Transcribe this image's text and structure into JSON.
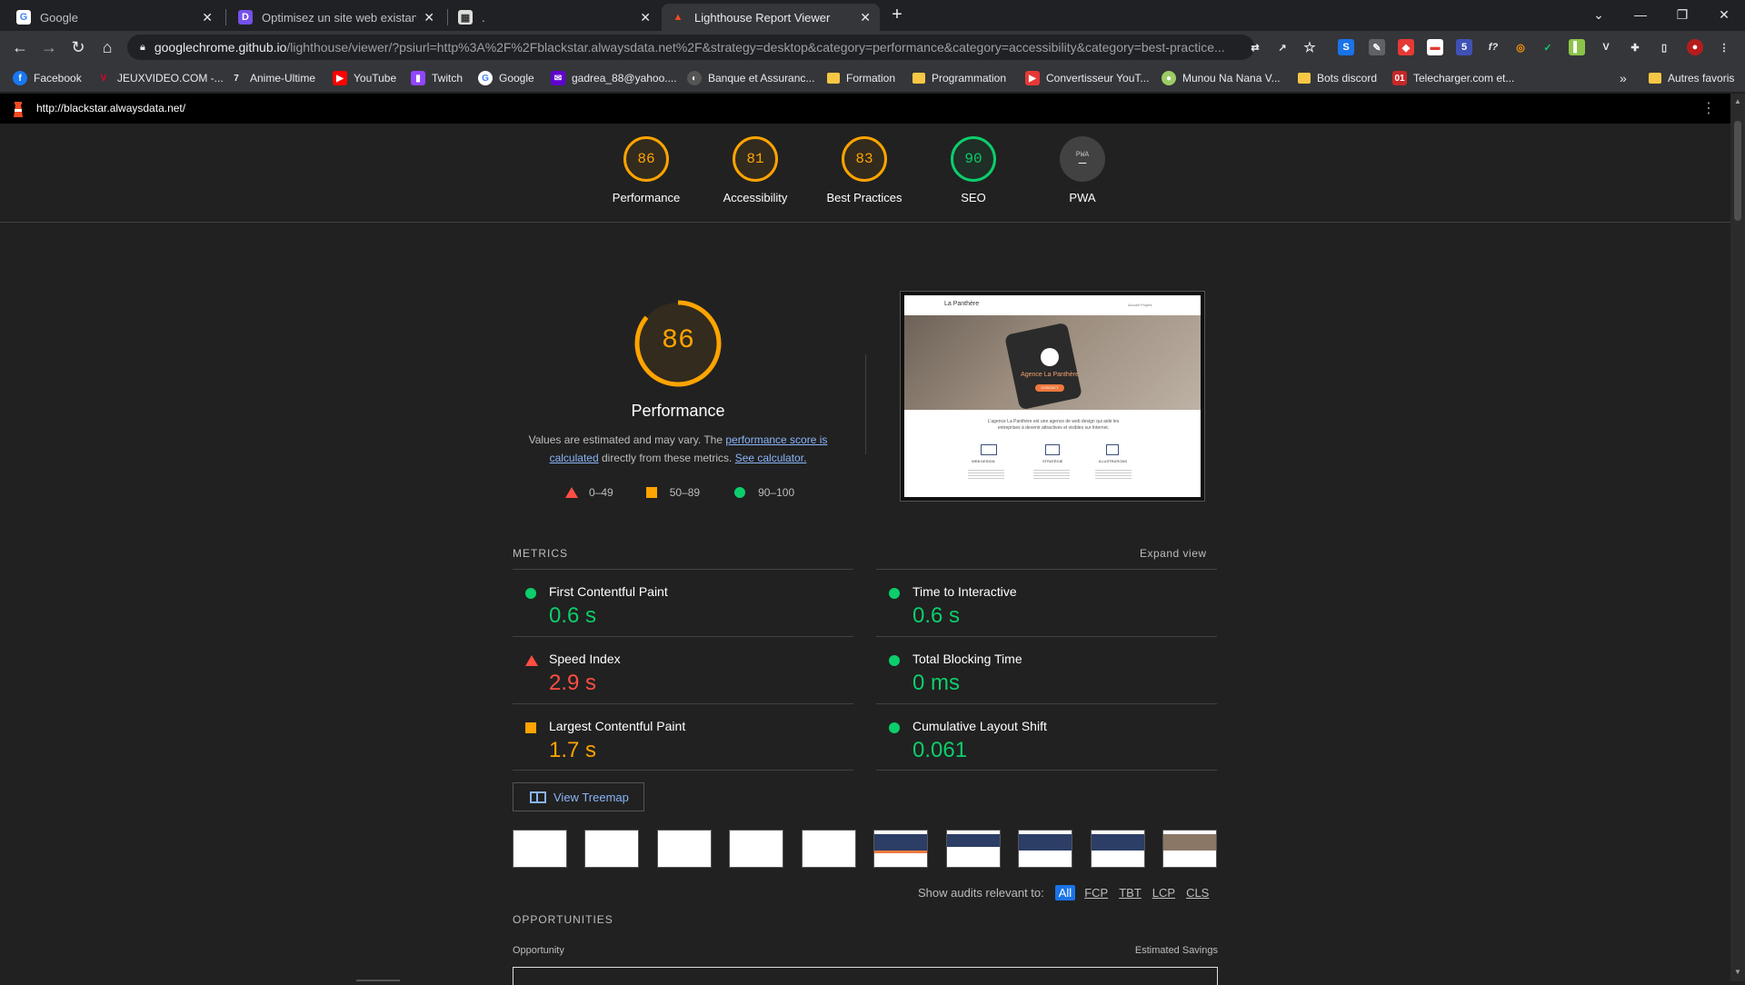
{
  "tabs": [
    {
      "title": "Google",
      "icon": "google-icon",
      "active": false
    },
    {
      "title": "Optimisez un site web existant - ",
      "icon": "openclassrooms-icon",
      "active": false
    },
    {
      "title": ".",
      "icon": "page-icon",
      "active": false
    },
    {
      "title": "Lighthouse Report Viewer",
      "icon": "lighthouse-icon",
      "active": true
    }
  ],
  "new_tab_label": "+",
  "url": {
    "host": "googlechrome.github.io",
    "rest": "/lighthouse/viewer/?psiurl=http%3A%2F%2Fblackstar.alwaysdata.net%2F&strategy=desktop&category=performance&category=accessibility&category=best-practice..."
  },
  "bookmarks": [
    {
      "label": "Facebook",
      "icon": "facebook-icon",
      "color": "#1877f2"
    },
    {
      "label": "JEUXVIDEO.COM -...",
      "icon": "jvc-icon",
      "color": "#e4002b"
    },
    {
      "label": "Anime-Ultime",
      "icon": "anime-icon",
      "color": "#444"
    },
    {
      "label": "YouTube",
      "icon": "youtube-icon",
      "color": "#ff0000"
    },
    {
      "label": "Twitch",
      "icon": "twitch-icon",
      "color": "#9146ff"
    },
    {
      "label": "Google",
      "icon": "google-icon",
      "color": "#4285f4"
    },
    {
      "label": "gadrea_88@yahoo....",
      "icon": "yahoo-icon",
      "color": "#6001d2"
    },
    {
      "label": "Banque et Assuranc...",
      "icon": "bank-icon",
      "color": "#555"
    },
    {
      "label": "Formation",
      "icon": "folder-icon",
      "color": "#f6c744"
    },
    {
      "label": "Programmation",
      "icon": "folder-icon",
      "color": "#f6c744"
    },
    {
      "label": "Convertisseur YouT...",
      "icon": "converter-icon",
      "color": "#e53935"
    },
    {
      "label": "Munou Na Nana V...",
      "icon": "munou-icon",
      "color": "#9ccc65"
    },
    {
      "label": "Bots discord",
      "icon": "folder-icon",
      "color": "#f6c744"
    },
    {
      "label": "Telecharger.com et...",
      "icon": "telecharger-icon",
      "color": "#c62828"
    }
  ],
  "bookmarks_more": "»",
  "other_bookmarks": "Autres favoris",
  "report_url": "http://blackstar.alwaysdata.net/",
  "scores": [
    {
      "label": "Performance",
      "value": "86",
      "status": "average"
    },
    {
      "label": "Accessibility",
      "value": "81",
      "status": "average"
    },
    {
      "label": "Best Practices",
      "value": "83",
      "status": "average"
    },
    {
      "label": "SEO",
      "value": "90",
      "status": "pass"
    },
    {
      "label": "PWA",
      "value": "PWA",
      "status": "na"
    }
  ],
  "performance": {
    "score": "86",
    "title": "Performance",
    "desc_start": "Values are estimated and may vary. The ",
    "desc_link1": "performance score is calculated",
    "desc_mid": " directly from these metrics. ",
    "desc_link2": "See calculator."
  },
  "legend": [
    {
      "range": "0–49",
      "shape": "triangle",
      "color": "#ff4e42"
    },
    {
      "range": "50–89",
      "shape": "square",
      "color": "#ffa400"
    },
    {
      "range": "90–100",
      "shape": "circle",
      "color": "#0cce6b"
    }
  ],
  "screenshot_preview": {
    "site_name": "La Panthère",
    "hero_text": "Agence La Panthère",
    "hero_button": "CONTACT",
    "nav": "Accueil   Projets",
    "intro": "L'agence La Panthère est une agence de web design qui aide les entreprises à devenir attractives et visibles sur Internet.",
    "features": [
      "WEB DESIGN",
      "STRATÉGIE",
      "ILLUSTRATIONS"
    ]
  },
  "metrics_header": "METRICS",
  "expand_view": "Expand view",
  "metrics": [
    {
      "name": "First Contentful Paint",
      "value": "0.6 s",
      "status": "pass"
    },
    {
      "name": "Time to Interactive",
      "value": "0.6 s",
      "status": "pass"
    },
    {
      "name": "Speed Index",
      "value": "2.9 s",
      "status": "fail"
    },
    {
      "name": "Total Blocking Time",
      "value": "0 ms",
      "status": "pass"
    },
    {
      "name": "Largest Contentful Paint",
      "value": "1.7 s",
      "status": "average"
    },
    {
      "name": "Cumulative Layout Shift",
      "value": "0.061",
      "status": "pass"
    }
  ],
  "view_treemap": "View Treemap",
  "filmstrip_count": 10,
  "show_audits_label": "Show audits relevant to:",
  "audit_filters": [
    "All",
    "FCP",
    "TBT",
    "LCP",
    "CLS"
  ],
  "opportunities_header": "OPPORTUNITIES",
  "opportunity_col": "Opportunity",
  "savings_col": "Estimated Savings",
  "colors": {
    "pass": "#0cce6b",
    "average": "#ffa400",
    "fail": "#ff4e42",
    "link": "#8ab4f8",
    "accent": "#1a73e8"
  }
}
